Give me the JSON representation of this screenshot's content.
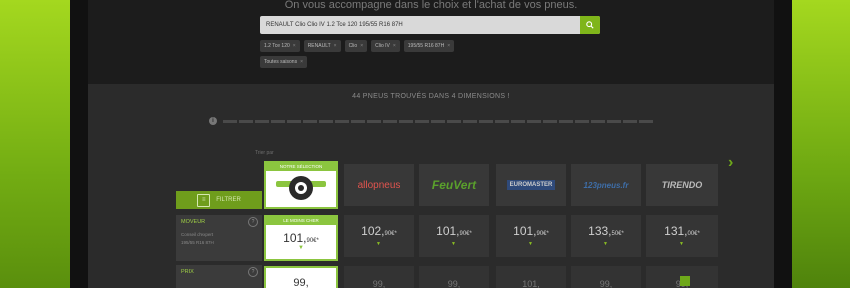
{
  "hero": {
    "text": "On vous accompagne dans le choix et l'achat de vos pneus."
  },
  "search": {
    "value": "RENAULT Clio Clio IV 1.2 Tce 120 195/55 R16 87H"
  },
  "chips_row1": [
    {
      "label": "1.2 Tce 120"
    },
    {
      "label": "RENAULT"
    },
    {
      "label": "Clio"
    },
    {
      "label": "Clio IV"
    },
    {
      "label": "195/55 R16 87H"
    }
  ],
  "chips_row2": [
    {
      "label": "Toutes saisons"
    }
  ],
  "heading": "44 PNEUS TROUVÉS DANS 4 DIMENSIONS !",
  "sort_label": "Trier par",
  "filters": {
    "label": "FILTRER"
  },
  "panels": [
    {
      "title": "MOVEUR",
      "lines": [
        "Conseil d'expert",
        "195/55 R16 87H"
      ]
    },
    {
      "title": "PRIX"
    }
  ],
  "featured": {
    "header": "NOTRE SÉLECTION",
    "moins_cher": "LE MOINS CHER",
    "price": "101,90€*",
    "price_main": "101,",
    "price_sub": "90€*",
    "next_price": "99,"
  },
  "moins_cher_tag": "LE MOINS CHER",
  "retailers": [
    {
      "name": "allopneus",
      "price_main": "102,",
      "price_sub": "90€*"
    },
    {
      "name": "FeuVert",
      "price_main": "101,",
      "price_sub": "90€*"
    },
    {
      "name": "EUROMASTER",
      "price_main": "101,",
      "price_sub": "90€*"
    },
    {
      "name": "123pneus.fr",
      "price_main": "133,",
      "price_sub": "50€*"
    },
    {
      "name": "TIRENDO",
      "price_main": "131,",
      "price_sub": "00€*"
    }
  ],
  "row3_prices": [
    "99,",
    "99,",
    "101,",
    "99,",
    "99,"
  ],
  "colors": {
    "accent": "#8bc53f",
    "background_green": "#7fb51a"
  },
  "icons": [
    "search-icon",
    "info-icon",
    "filter-icon",
    "help-icon",
    "chevron-right-icon",
    "close-icon",
    "tire-icon"
  ]
}
